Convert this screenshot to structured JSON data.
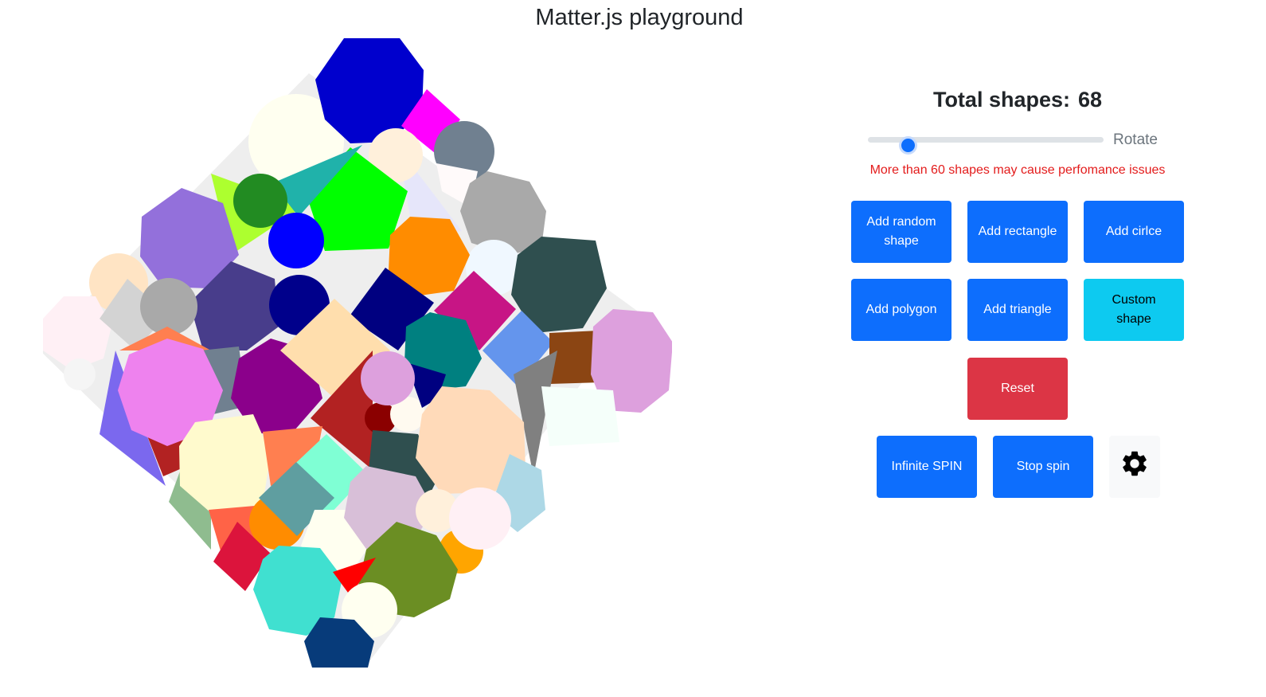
{
  "app": {
    "title": "Matter.js playground"
  },
  "stats": {
    "total_label": "Total shapes:",
    "total_count": "68"
  },
  "rotate": {
    "label": "Rotate",
    "value": 0.15
  },
  "warning": "More than 60 shapes may cause perfomance issues",
  "buttons": {
    "add_random": "Add random shape",
    "add_rectangle": "Add rectangle",
    "add_circle": "Add cirlce",
    "add_polygon": "Add polygon",
    "add_triangle": "Add triangle",
    "custom_shape": "Custom shape",
    "reset": "Reset",
    "infinite_spin": "Infinite SPIN",
    "stop_spin": "Stop spin"
  },
  "icons": {
    "settings": "gear-icon"
  },
  "colors": {
    "primary": "#0d6efd",
    "info": "#0dcaf0",
    "danger": "#dc3545",
    "warning_text": "#e31b1b",
    "container": "#eeeeee"
  }
}
